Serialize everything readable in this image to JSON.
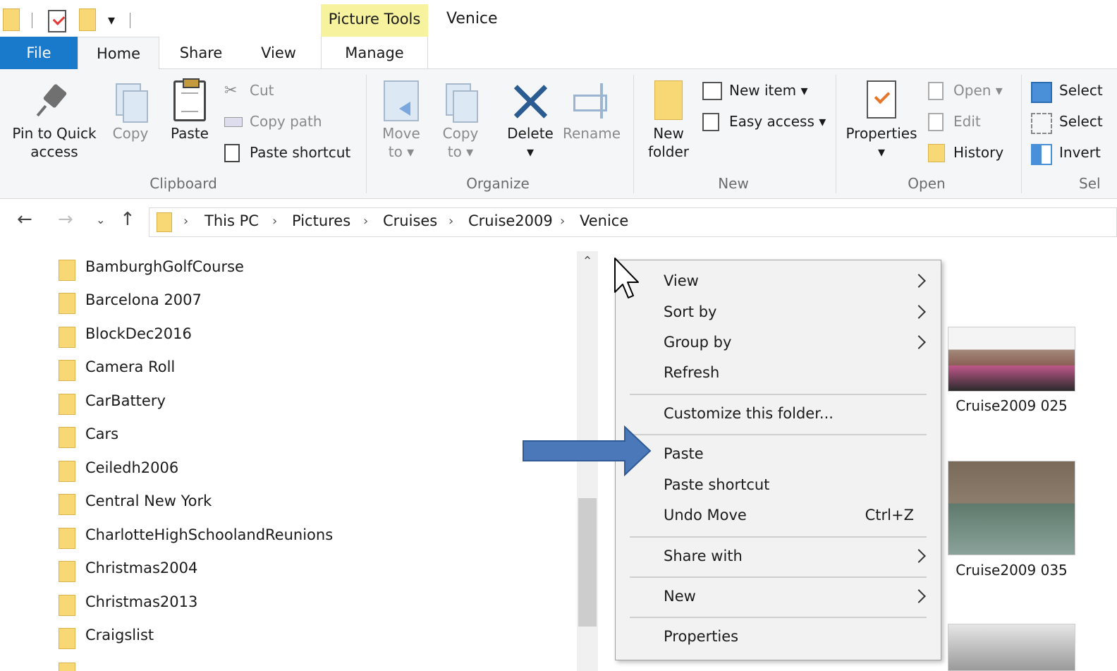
{
  "window": {
    "contextual_tab_group": "Picture Tools",
    "title": "Venice"
  },
  "tabs": {
    "file": "File",
    "home": "Home",
    "share": "Share",
    "view": "View",
    "manage": "Manage"
  },
  "ribbon": {
    "clipboard": {
      "group_label": "Clipboard",
      "pin_quick_access": [
        "Pin to Quick",
        "access"
      ],
      "copy": "Copy",
      "paste": "Paste",
      "cut": "Cut",
      "copy_path": "Copy path",
      "paste_shortcut": "Paste shortcut"
    },
    "organize": {
      "group_label": "Organize",
      "move_to": [
        "Move",
        "to ▾"
      ],
      "copy_to": [
        "Copy",
        "to ▾"
      ],
      "delete": "Delete",
      "rename": "Rename"
    },
    "new": {
      "group_label": "New",
      "new_folder": [
        "New",
        "folder"
      ],
      "new_item": "New item ▾",
      "easy_access": "Easy access ▾"
    },
    "open": {
      "group_label": "Open",
      "properties": "Properties",
      "open": "Open ▾",
      "edit": "Edit",
      "history": "History"
    },
    "select": {
      "group_label": "Sel",
      "select_all": "Select",
      "select_none": "Select",
      "invert": "Invert"
    }
  },
  "address": {
    "breadcrumbs": [
      "This PC",
      "Pictures",
      "Cruises",
      "Cruise2009",
      "Venice"
    ]
  },
  "folders": [
    "BamburghGolfCourse",
    "Barcelona 2007",
    "BlockDec2016",
    "Camera Roll",
    "CarBattery",
    "Cars",
    "Ceiledh2006",
    "Central New York",
    "CharlotteHighSchoolandReunions",
    "Christmas2004",
    "Christmas2013",
    "Craigslist"
  ],
  "thumbnails": [
    {
      "label": "Cruise2009 025"
    },
    {
      "label": "Cruise2009 035"
    }
  ],
  "context_menu": {
    "view": "View",
    "sort_by": "Sort by",
    "group_by": "Group by",
    "refresh": "Refresh",
    "customize": "Customize this folder...",
    "paste": "Paste",
    "paste_shortcut": "Paste shortcut",
    "undo_move": "Undo Move",
    "undo_move_shortcut": "Ctrl+Z",
    "share_with": "Share with",
    "new": "New",
    "properties": "Properties"
  },
  "colors": {
    "file_tab": "#1979ca",
    "picture_tools": "#f6f29e",
    "folder": "#f8d775",
    "annotation_arrow": "#4a78b8"
  }
}
